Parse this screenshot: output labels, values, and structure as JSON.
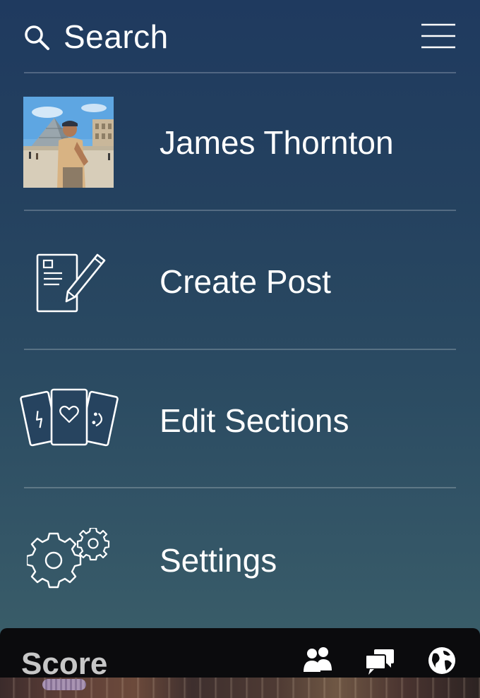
{
  "header": {
    "search_label": "Search",
    "search_icon": "search-icon",
    "menu_icon": "hamburger-menu-icon"
  },
  "menu": {
    "items": [
      {
        "label": "James Thornton",
        "icon": "profile-avatar"
      },
      {
        "label": "Create Post",
        "icon": "create-post-icon"
      },
      {
        "label": "Edit Sections",
        "icon": "section-cards-icon"
      },
      {
        "label": "Settings",
        "icon": "gears-icon"
      }
    ]
  },
  "dock": {
    "title": "Score",
    "icons": [
      "people-icon",
      "chat-bubbles-icon",
      "globe-icon"
    ]
  },
  "colors": {
    "background_top": "#1f3a5f",
    "background_bottom": "#3d6169",
    "text": "#ffffff",
    "dock_bg": "#0b0b0d",
    "dock_title": "#c7c7c7"
  }
}
